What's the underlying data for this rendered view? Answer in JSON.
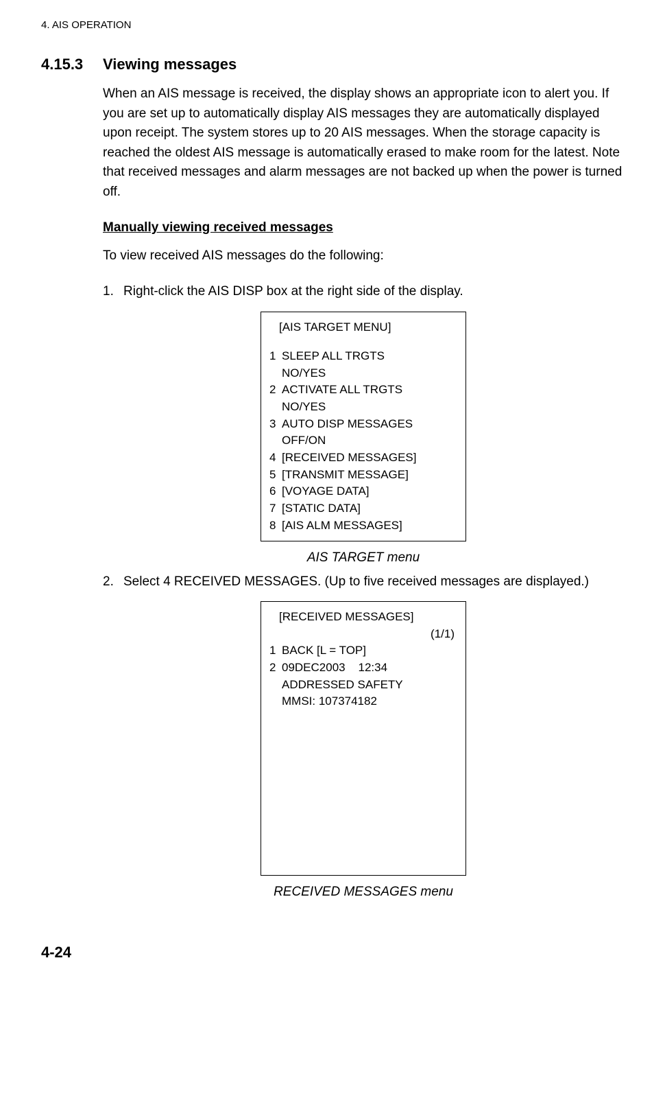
{
  "chapter_header": "4. AIS OPERATION",
  "section": {
    "number": "4.15.3",
    "title": "Viewing messages"
  },
  "intro_paragraph": "When an AIS message is received, the display shows an appropriate icon to alert you. If you are set up to automatically display AIS messages they are automatically displayed upon receipt. The system stores up to 20 AIS messages. When the storage capacity is reached the oldest AIS message is automatically erased to make room for the latest. Note that received messages and alarm messages are not backed up when the power is turned off.",
  "sub_heading": "Manually viewing received messages",
  "sub_intro": "To view received AIS messages do the following:",
  "step1": {
    "num": "1.",
    "text": "Right-click the AIS DISP box at the right side of the display."
  },
  "menu1": {
    "title": "[AIS TARGET MENU]",
    "items": [
      {
        "n": "1",
        "label": "SLEEP ALL TRGTS",
        "opt": "NO/YES"
      },
      {
        "n": "2",
        "label": "ACTIVATE ALL TRGTS",
        "opt": "NO/YES"
      },
      {
        "n": "3",
        "label": "AUTO DISP MESSAGES",
        "opt": "OFF/ON"
      },
      {
        "n": "4",
        "label": "[RECEIVED MESSAGES]"
      },
      {
        "n": "5",
        "label": "[TRANSMIT MESSAGE]"
      },
      {
        "n": "6",
        "label": "[VOYAGE DATA]"
      },
      {
        "n": "7",
        "label": "[STATIC DATA]"
      },
      {
        "n": "8",
        "label": "[AIS ALM MESSAGES]"
      }
    ]
  },
  "caption1": "AIS TARGET menu",
  "step2": {
    "num": "2.",
    "text": "Select 4 RECEIVED MESSAGES. (Up to five received messages are displayed.)"
  },
  "menu2": {
    "title": "[RECEIVED MESSAGES]",
    "page": "(1/1)",
    "item1": {
      "n": "1",
      "label": "BACK [L = TOP]"
    },
    "item2": {
      "n": "2",
      "line1": "09DEC2003    12:34",
      "line2": "ADDRESSED SAFETY",
      "line3": "MMSI: 107374182"
    }
  },
  "caption2": "RECEIVED MESSAGES menu",
  "page_number": "4-24"
}
